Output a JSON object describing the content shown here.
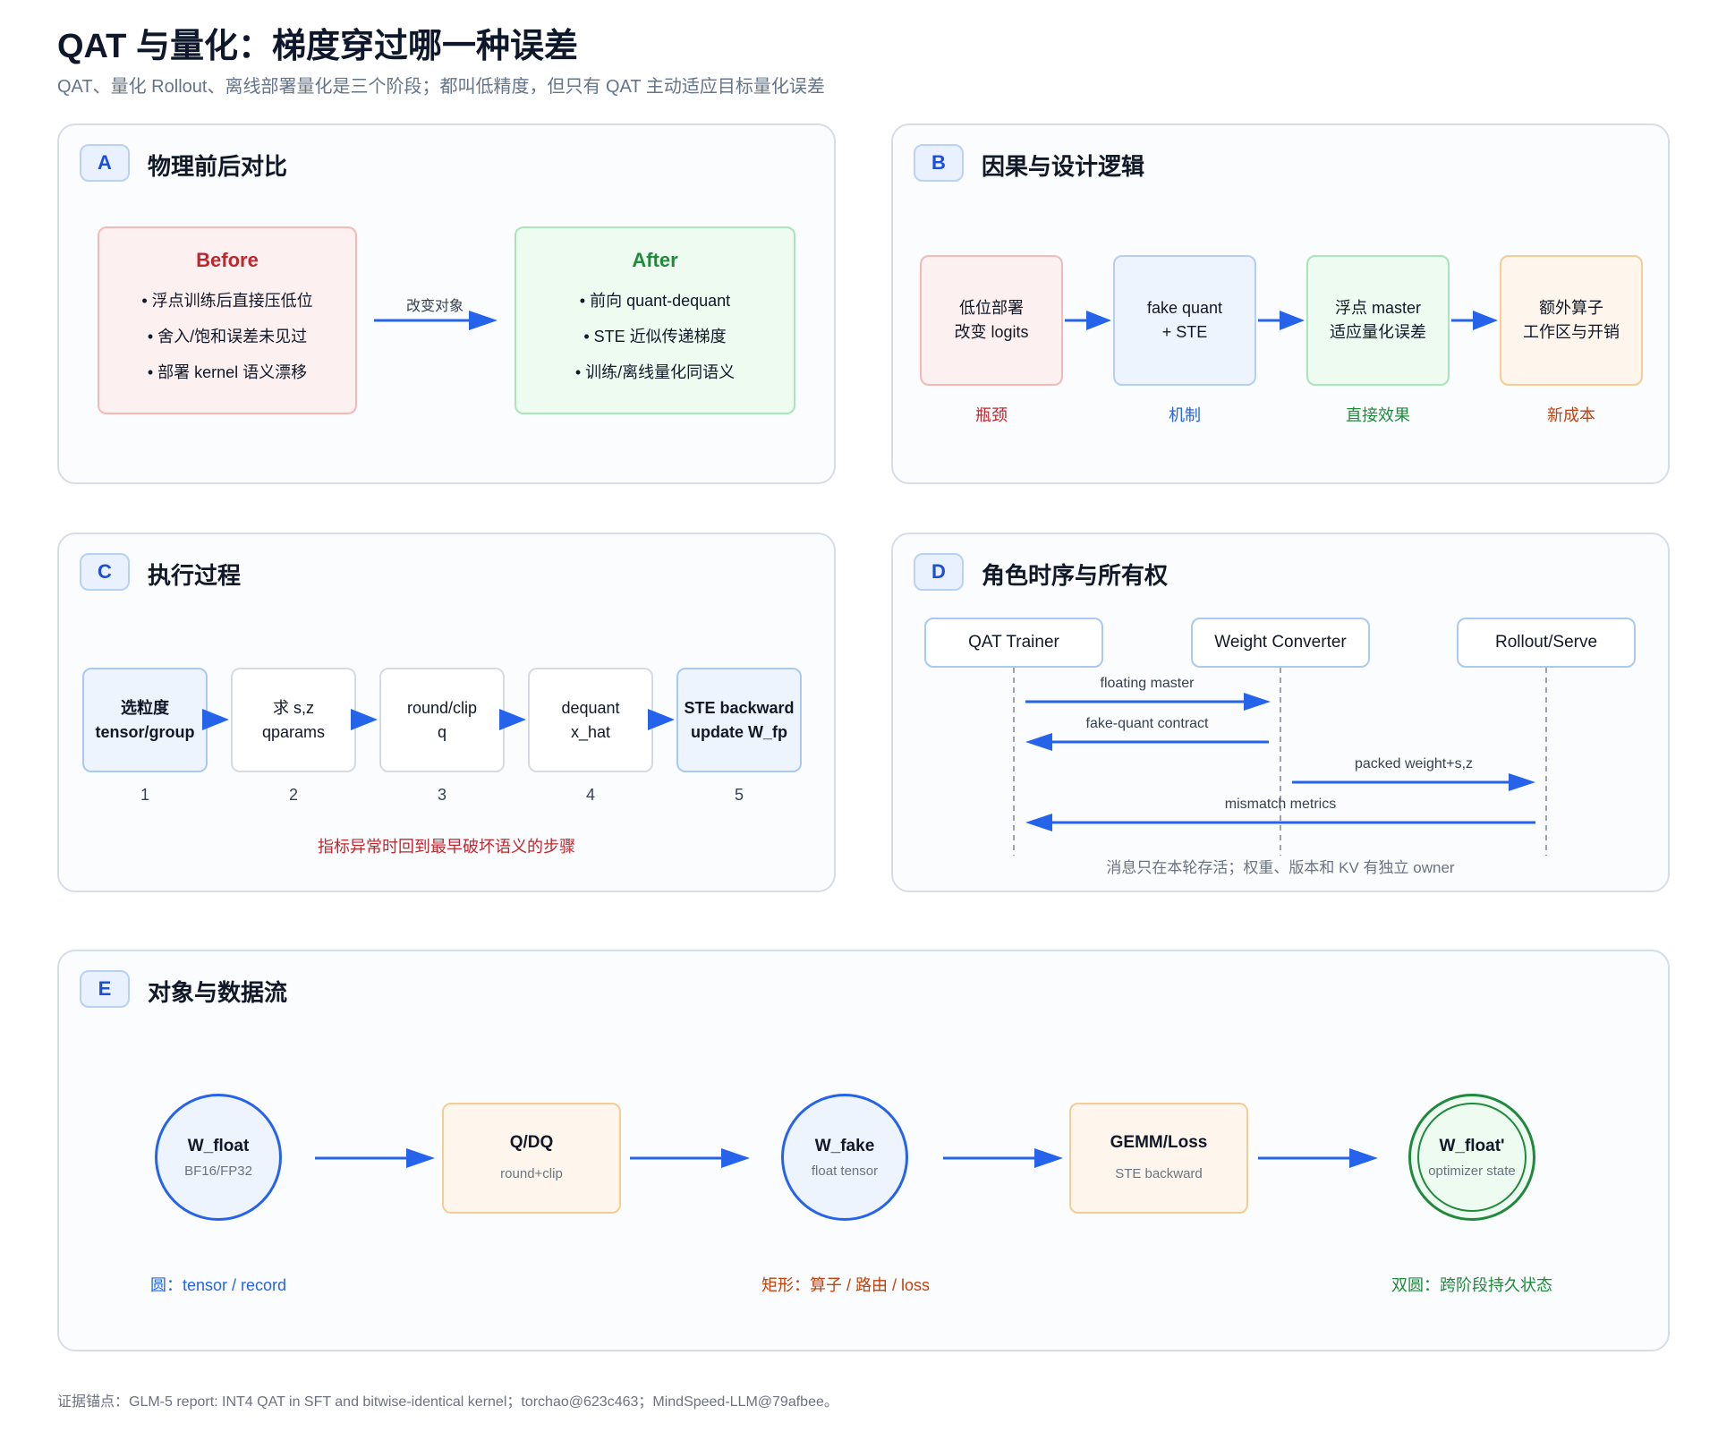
{
  "header": {
    "title": "QAT 与量化：梯度穿过哪一种误差",
    "subtitle": "QAT、量化 Rollout、离线部署量化是三个阶段；都叫低精度，但只有 QAT 主动适应目标量化误差"
  },
  "panels": {
    "a": {
      "badge": "A",
      "title": "物理前后对比",
      "before": {
        "title": "Before",
        "items": [
          "• 浮点训练后直接压低位",
          "• 舍入/饱和误差未见过",
          "• 部署 kernel 语义漂移"
        ]
      },
      "arrow_label": "改变对象",
      "after": {
        "title": "After",
        "items": [
          "• 前向 quant-dequant",
          "• STE 近似传递梯度",
          "• 训练/离线量化同语义"
        ]
      }
    },
    "b": {
      "badge": "B",
      "title": "因果与设计逻辑",
      "boxes": [
        {
          "l1": "低位部署",
          "l2": "改变 logits",
          "caption": "瓶颈"
        },
        {
          "l1": "fake quant",
          "l2": "+ STE",
          "caption": "机制"
        },
        {
          "l1": "浮点 master",
          "l2": "适应量化误差",
          "caption": "直接效果"
        },
        {
          "l1": "额外算子",
          "l2": "工作区与开销",
          "caption": "新成本"
        }
      ]
    },
    "c": {
      "badge": "C",
      "title": "执行过程",
      "steps": [
        {
          "l1": "选粒度",
          "l2": "tensor/group",
          "num": "1"
        },
        {
          "l1": "求 s,z",
          "l2": "qparams",
          "num": "2"
        },
        {
          "l1": "round/clip",
          "l2": "q",
          "num": "3"
        },
        {
          "l1": "dequant",
          "l2": "x_hat",
          "num": "4"
        },
        {
          "l1": "STE backward",
          "l2": "update W_fp",
          "num": "5"
        }
      ],
      "note": "指标异常时回到最早破坏语义的步骤"
    },
    "d": {
      "badge": "D",
      "title": "角色时序与所有权",
      "actors": [
        "QAT Trainer",
        "Weight Converter",
        "Rollout/Serve"
      ],
      "messages": [
        "floating master",
        "fake-quant contract",
        "packed weight+s,z",
        "mismatch metrics"
      ],
      "note": "消息只在本轮存活；权重、版本和 KV 有独立 owner"
    },
    "e": {
      "badge": "E",
      "title": "对象与数据流",
      "nodes": [
        {
          "main": "W_float",
          "sub": "BF16/FP32"
        },
        {
          "main": "Q/DQ",
          "sub": "round+clip"
        },
        {
          "main": "W_fake",
          "sub": "float tensor"
        },
        {
          "main": "GEMM/Loss",
          "sub": "STE backward"
        },
        {
          "main": "W_float'",
          "sub": "optimizer state"
        }
      ],
      "legend": [
        "圆：tensor / record",
        "矩形：算子 / 路由 / loss",
        "双圆：跨阶段持久状态"
      ]
    }
  },
  "footer": "证据锚点：GLM-5 report: INT4 QAT in SFT and bitwise-identical kernel；torchao@623c463；MindSpeed-LLM@79afbee。",
  "colors": {
    "accent": "#2563eb",
    "before_red": "#c0262d",
    "after_green": "#1f8a3c",
    "cost_orange": "#c2410c",
    "note_red": "#c0262d"
  }
}
